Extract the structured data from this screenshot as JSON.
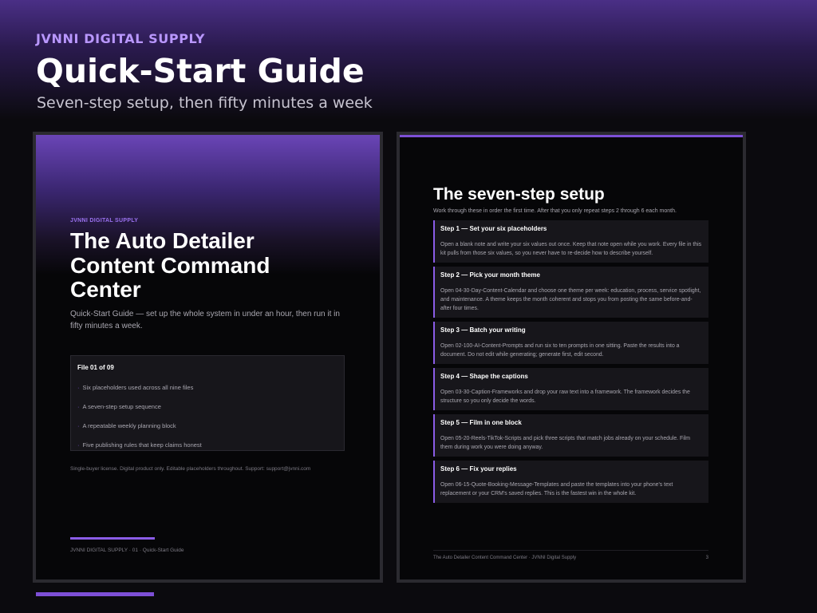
{
  "header": {
    "brand": "JVNNI DIGITAL SUPPLY",
    "title": "Quick-Start Guide",
    "subtitle": "Seven-step setup, then fifty minutes a week"
  },
  "cover": {
    "brand": "JVNNI DIGITAL SUPPLY",
    "title": "The Auto Detailer Content Command Center",
    "description": "Quick-Start Guide — set up the whole system in under an hour, then run it in fifty minutes a week.",
    "file_label": "File 01 of 09",
    "bullet": "·",
    "items": [
      "Six placeholders used across all nine files",
      "A seven-step setup sequence",
      "A repeatable weekly planning block",
      "Five publishing rules that keep claims honest"
    ],
    "license": "Single-buyer license. Digital product only. Editable placeholders throughout. Support: support@jvnni.com",
    "footer": "JVNNI DIGITAL SUPPLY  ·  01 · Quick-Start Guide"
  },
  "setup": {
    "title": "The seven-step setup",
    "intro": "Work through these in order the first time. After that you only repeat steps 2 through 6 each month.",
    "steps": [
      {
        "title": "Step 1 — Set your six placeholders",
        "body": "Open a blank note and write your six values out once. Keep that note open while you work. Every file in this kit pulls from those six values, so you never have to re-decide how to describe yourself."
      },
      {
        "title": "Step 2 — Pick your month theme",
        "body": "Open 04-30-Day-Content-Calendar and choose one theme per week: education, process, service spotlight, and maintenance. A theme keeps the month coherent and stops you from posting the same before-and-after four times."
      },
      {
        "title": "Step 3 — Batch your writing",
        "body": "Open 02-100-AI-Content-Prompts and run six to ten prompts in one sitting. Paste the results into a document. Do not edit while generating; generate first, edit second."
      },
      {
        "title": "Step 4 — Shape the captions",
        "body": "Open 03-30-Caption-Frameworks and drop your raw text into a framework. The framework decides the structure so you only decide the words."
      },
      {
        "title": "Step 5 — Film in one block",
        "body": "Open 05-20-Reels-TikTok-Scripts and pick three scripts that match jobs already on your schedule. Film them during work you were doing anyway."
      },
      {
        "title": "Step 6 — Fix your replies",
        "body": "Open 06-15-Quote-Booking-Message-Templates and paste the templates into your phone's text replacement or your CRM's saved replies. This is the fastest win in the whole kit."
      }
    ],
    "footer_left": "The Auto Detailer Content Command Center  ·  JVNNI Digital Supply",
    "page_number": "3"
  },
  "colors": {
    "accent": "#7d4fd6",
    "brand_text": "#b997ff"
  }
}
